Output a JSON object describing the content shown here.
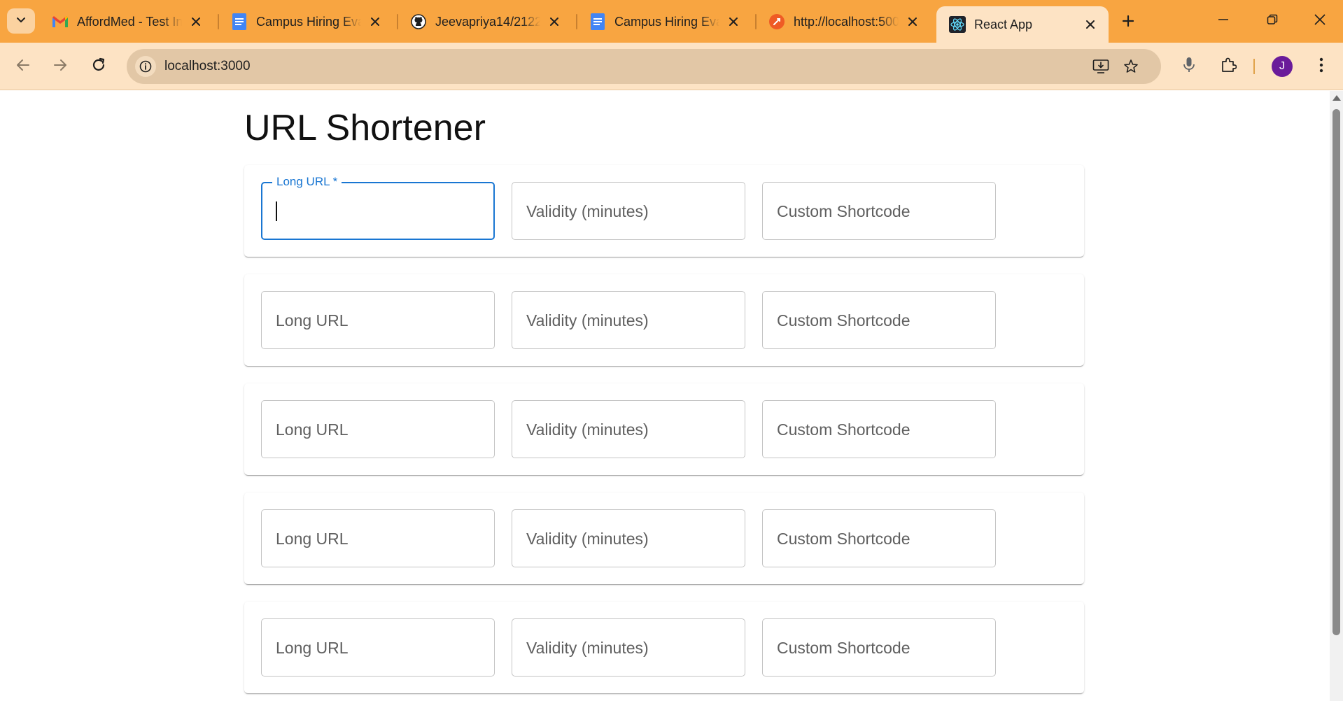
{
  "browser": {
    "tabs": [
      {
        "title": "AffordMed - Test In",
        "icon": "gmail-icon"
      },
      {
        "title": "Campus Hiring Eva",
        "icon": "google-docs-icon"
      },
      {
        "title": "Jeevapriya14/2122",
        "icon": "github-icon"
      },
      {
        "title": "Campus Hiring Eva",
        "icon": "google-docs-icon"
      },
      {
        "title": "http://localhost:500",
        "icon": "postman-icon"
      },
      {
        "title": "React App",
        "icon": "react-icon",
        "active": true
      }
    ],
    "address": "localhost:3000",
    "profile_initial": "J",
    "colors": {
      "tabstrip": "#f8a541",
      "toolbar": "#fde3c4",
      "omnibox": "#e2c7a6",
      "avatar": "#6a1b9a",
      "accent": "#1976d2"
    }
  },
  "page": {
    "title": "URL Shortener",
    "rows": [
      {
        "long_url": "Long URL *",
        "validity": "Validity (minutes)",
        "shortcode": "Custom Shortcode"
      },
      {
        "long_url": "Long URL",
        "validity": "Validity (minutes)",
        "shortcode": "Custom Shortcode"
      },
      {
        "long_url": "Long URL",
        "validity": "Validity (minutes)",
        "shortcode": "Custom Shortcode"
      },
      {
        "long_url": "Long URL",
        "validity": "Validity (minutes)",
        "shortcode": "Custom Shortcode"
      },
      {
        "long_url": "Long URL",
        "validity": "Validity (minutes)",
        "shortcode": "Custom Shortcode"
      }
    ]
  }
}
